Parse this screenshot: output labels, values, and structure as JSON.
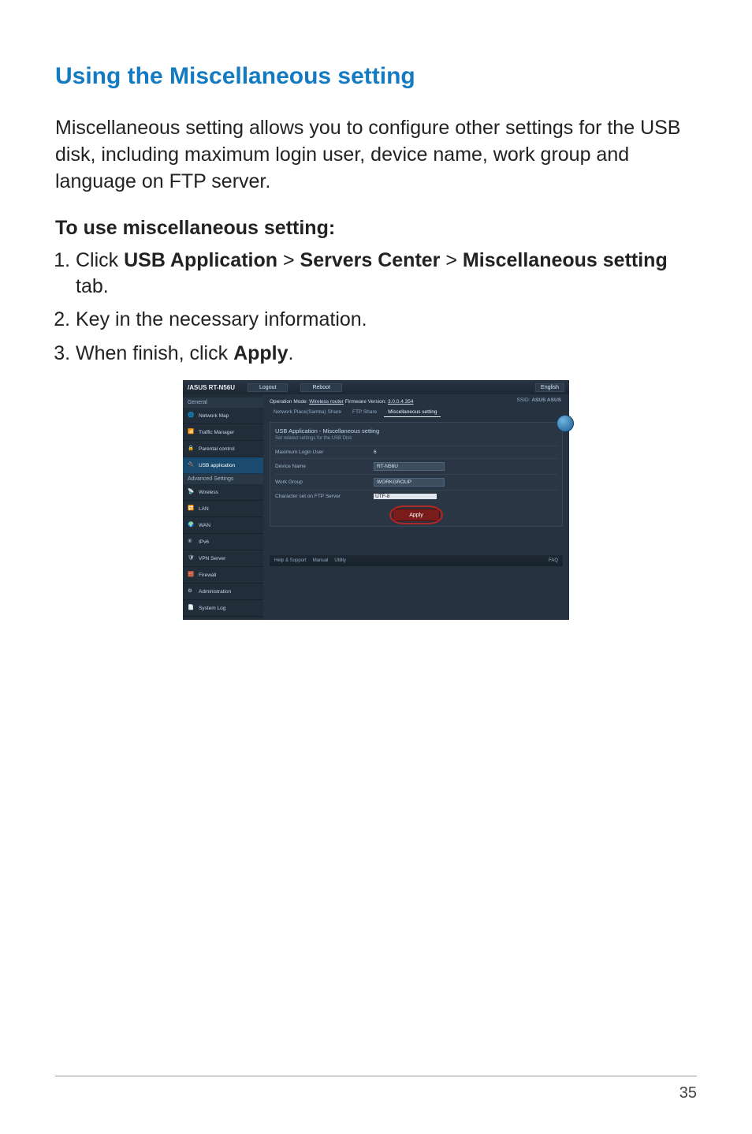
{
  "page": {
    "section_title": "Using the Miscellaneous setting",
    "intro": "Miscellaneous setting allows you to configure other settings for the USB disk, including maximum login user, device name, work group and language on FTP server.",
    "subheading": "To use miscellaneous setting:",
    "steps": {
      "s1_a": "Click ",
      "s1_b": "USB Application",
      "s1_c": " > ",
      "s1_d": "Servers Center",
      "s1_e": " > ",
      "s1_f": "Miscellaneous setting",
      "s1_g": " tab.",
      "s2": "Key in the necessary information.",
      "s3_a": "When finish, click ",
      "s3_b": "Apply",
      "s3_c": "."
    },
    "page_number": "35"
  },
  "ss": {
    "brand": "/ASUS RT-N56U",
    "top": {
      "logout": "Logout",
      "reboot": "Reboot",
      "lang": "English"
    },
    "sidebar": {
      "general_header": "General",
      "items_general": [
        {
          "label": "Network Map"
        },
        {
          "label": "Traffic Manager"
        },
        {
          "label": "Parental control"
        },
        {
          "label": "USB application",
          "active": true
        }
      ],
      "adv_header": "Advanced Settings",
      "items_adv": [
        {
          "label": "Wireless"
        },
        {
          "label": "LAN"
        },
        {
          "label": "WAN"
        },
        {
          "label": "IPv6"
        },
        {
          "label": "VPN Server"
        },
        {
          "label": "Firewall"
        },
        {
          "label": "Administration"
        },
        {
          "label": "System Log"
        }
      ]
    },
    "main": {
      "breadcrumb_mode": "Operation Mode: ",
      "breadcrumb_mode_val": "Wireless router",
      "breadcrumb_fw": "  Firmware Version: ",
      "breadcrumb_fw_val": "3.0.0.4.354",
      "ssid_label": "SSID: ",
      "ssid_val": "ASUS ASUS",
      "tabs": {
        "t1": "Network Place(Samba) Share",
        "t2": "FTP Share",
        "t3": "Miscellaneous setting"
      },
      "panel_title": "USB Application - Miscellaneous setting",
      "panel_sub": "Set related settings for the USB Disk",
      "rows": {
        "r1_l": "Maximum Login User",
        "r1_v": "6",
        "r2_l": "Device Name",
        "r2_v": "RT-N56U",
        "r3_l": "Work Group",
        "r3_v": "WORKGROUP",
        "r4_l": "Character set on FTP Server",
        "r4_v": "UTF-8"
      },
      "apply": "Apply"
    },
    "footer": {
      "left1": "Help & Support",
      "left2": "Manual",
      "left3": "Utility",
      "right": "FAQ"
    }
  }
}
